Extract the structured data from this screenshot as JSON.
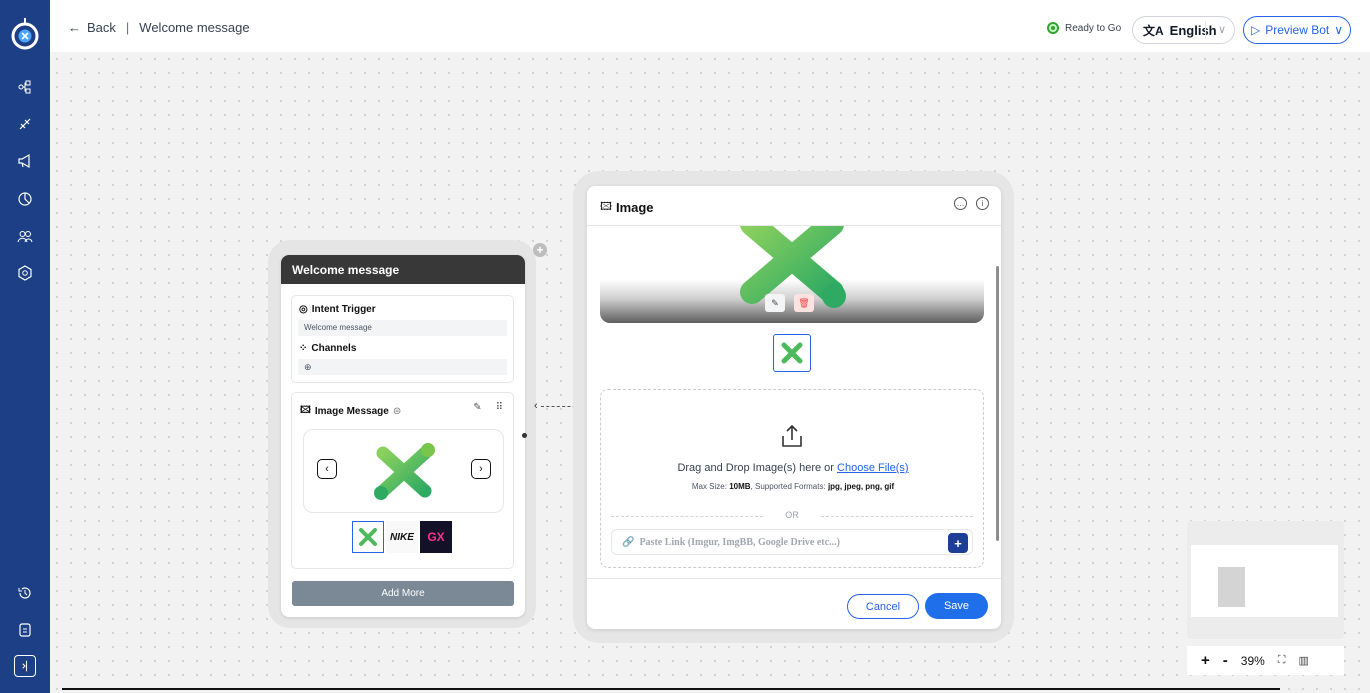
{
  "sidebar": {
    "items": [
      {
        "icon": "flow-icon"
      },
      {
        "icon": "integration-icon"
      },
      {
        "icon": "broadcast-icon"
      },
      {
        "icon": "analytics-icon"
      },
      {
        "icon": "users-icon"
      },
      {
        "icon": "settings-icon"
      }
    ],
    "bottom_items": [
      {
        "icon": "history-icon"
      },
      {
        "icon": "document-icon"
      },
      {
        "icon": "collapse-icon"
      }
    ]
  },
  "header": {
    "back_label": "Back",
    "title": "Welcome message",
    "status": "Ready to Go",
    "language": "English",
    "preview_label": "Preview Bot"
  },
  "node": {
    "title": "Welcome message",
    "intent_label": "Intent Trigger",
    "intent_value": "Welcome message",
    "channels_label": "Channels",
    "message_label": "Image Message",
    "thumbnails": [
      "X logo",
      "NIKE",
      "GX"
    ],
    "add_more": "Add More"
  },
  "panel": {
    "title": "Image",
    "drop_text": "Drag and Drop Image(s) here or",
    "choose_link": "Choose File(s)",
    "max_size_prefix": "Max Size:",
    "max_size": "10MB",
    "formats_prefix": ", Supported Formats:",
    "formats": "jpg, jpeg, png, gif",
    "or": "OR",
    "paste_placeholder": "Paste Link (Imgur, ImgBB, Google Drive etc...)",
    "cancel": "Cancel",
    "save": "Save"
  },
  "zoom": {
    "plus": "+",
    "minus": "-",
    "level": "39%"
  },
  "colors": {
    "sidebar": "#1c3f86",
    "accent": "#2563eb",
    "logo_green": "#4caf50",
    "node_header": "#383838"
  }
}
